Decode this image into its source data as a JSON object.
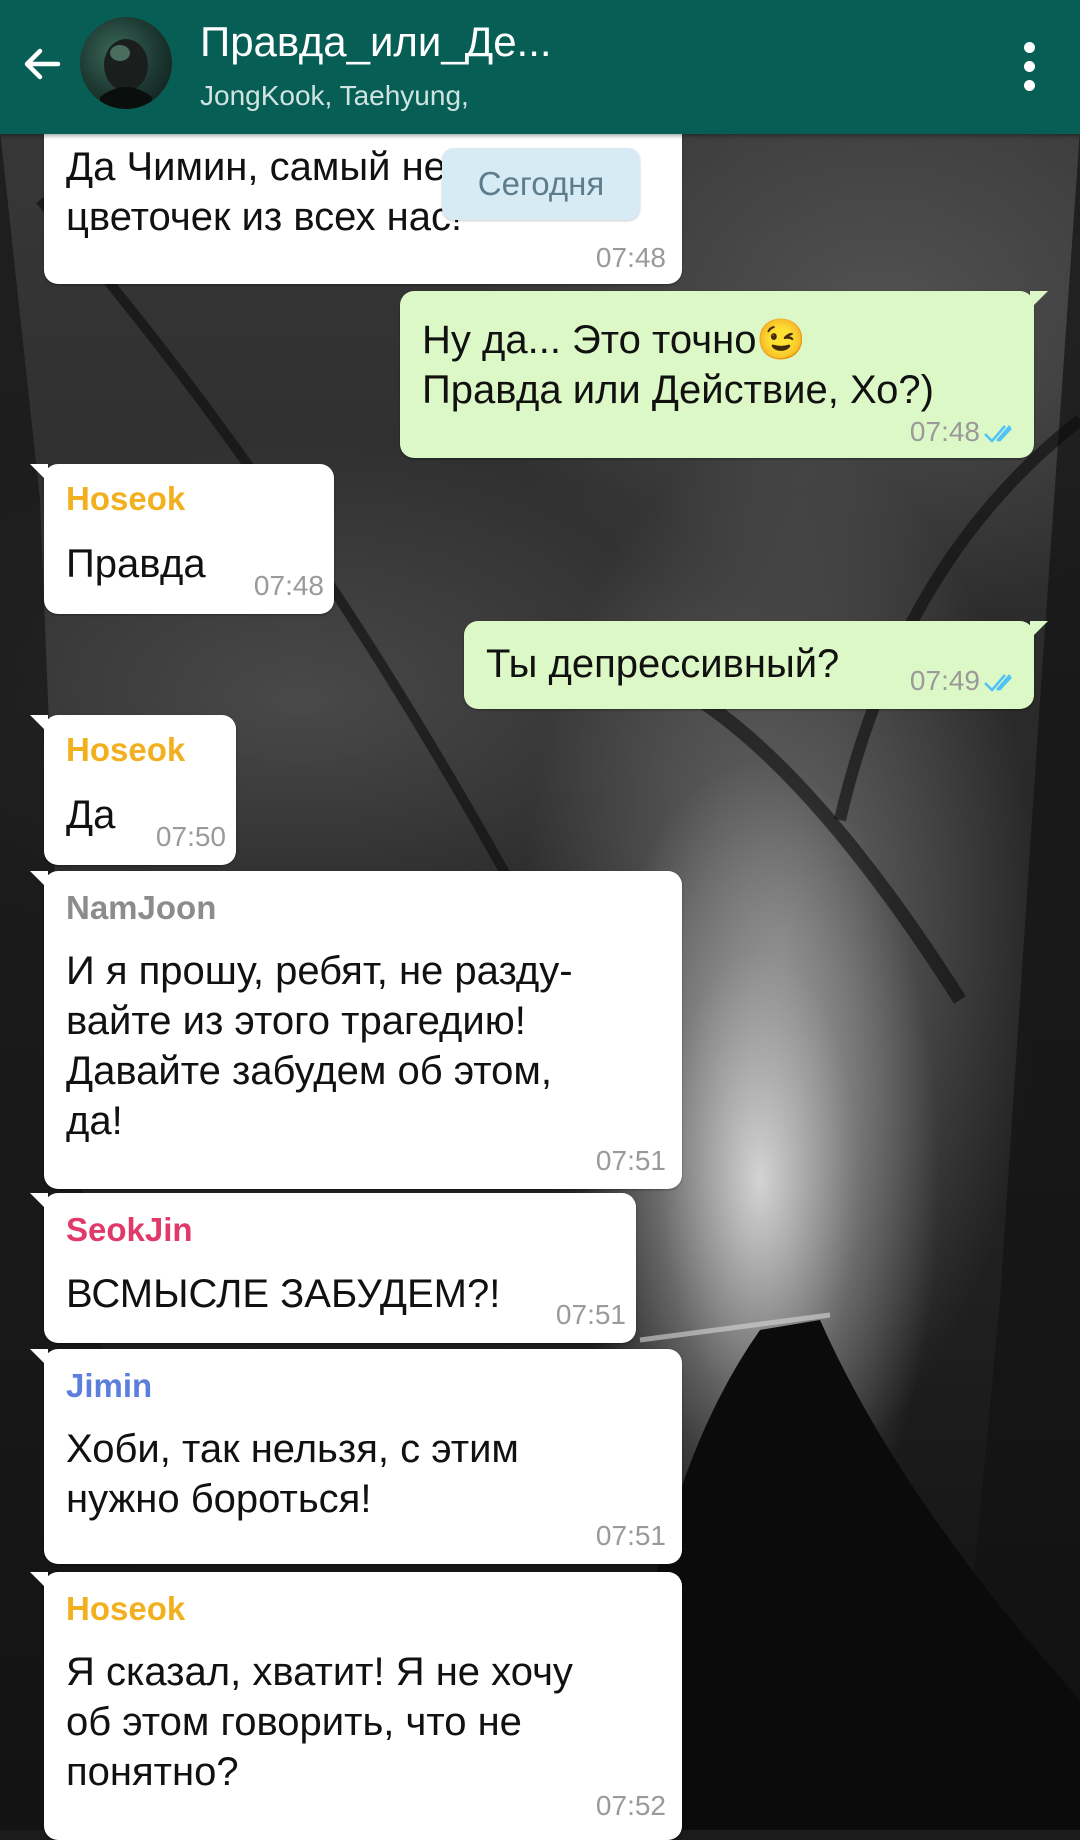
{
  "header": {
    "title": "Правда_или_Де...",
    "subtitle": "JongKook, Taehyung,"
  },
  "day_chip": "Сегодня",
  "messages": [
    {
      "text": "Да Чимин, самый нежный\nцветочек из всех нас!",
      "time": "07:48"
    },
    {
      "text": "Ну да... Это точно😉\nПравда или Действие, Хо?)",
      "time": "07:48"
    },
    {
      "sender": "Hoseok",
      "text": "Правда",
      "time": "07:48"
    },
    {
      "text": "Ты депрессивный?",
      "time": "07:49"
    },
    {
      "sender": "Hoseok",
      "text": "Да",
      "time": "07:50"
    },
    {
      "sender": "NamJoon",
      "text": "И я прошу, ребят, не разду-\nвайте из этого трагедию!\nДавайте забудем об этом,\nда!",
      "time": "07:51"
    },
    {
      "sender": "SeokJin",
      "text": "ВСМЫСЛЕ ЗАБУДЕМ?!",
      "time": "07:51"
    },
    {
      "sender": "Jimin",
      "text": "Хоби, так нельзя, с этим\nнужно бороться!",
      "time": "07:51"
    },
    {
      "sender": "Hoseok",
      "text": "Я сказал, хватит! Я не хочу\nоб этом говорить, что не\nпонятно?",
      "time": "07:52"
    }
  ],
  "colors": {
    "header": "#075e55",
    "outgoing_bubble": "#dcf8c6",
    "incoming_bubble": "#ffffff",
    "sender_hoseok": "#f2b01e",
    "sender_namjoon": "#8c8c8c",
    "sender_seokjin": "#e0396a",
    "sender_jimin": "#5b7fdb",
    "read_ticks": "#4fc3f7"
  },
  "icons": {
    "back": "back-arrow-icon",
    "menu": "more-vert-icon",
    "read": "double-check-icon"
  }
}
